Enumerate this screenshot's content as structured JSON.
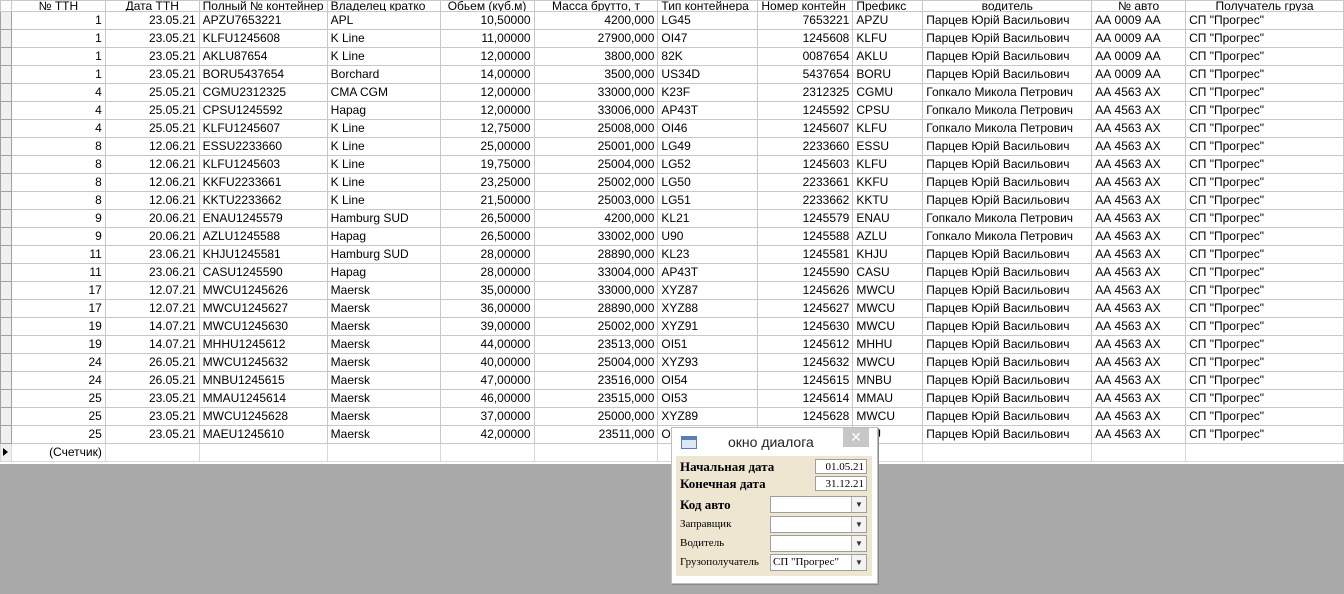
{
  "columns": [
    "№ ТТН",
    "Дата ТТН",
    "Полный № контейнер",
    "Владелец кратко",
    "Обьем (куб.м)",
    "Масса брутто, т",
    "Тип контейнера",
    "Номер контейн",
    "Префикс",
    "водитель",
    "№ авто",
    "Получатель груза"
  ],
  "rows": [
    [
      "1",
      "23.05.21",
      "APZU7653221",
      "APL",
      "10,50000",
      "4200,000",
      "LG45",
      "7653221",
      "APZU",
      "Парцев Юрій Васильович",
      "АА 0009 АА",
      "СП \"Прогрес\""
    ],
    [
      "1",
      "23.05.21",
      "KLFU1245608",
      "K Line",
      "11,00000",
      "27900,000",
      "OI47",
      "1245608",
      "KLFU",
      "Парцев Юрій Васильович",
      "АА 0009 АА",
      "СП \"Прогрес\""
    ],
    [
      "1",
      "23.05.21",
      "AKLU87654",
      "K Line",
      "12,00000",
      "3800,000",
      "82K",
      "0087654",
      "AKLU",
      "Парцев Юрій Васильович",
      "АА 0009 АА",
      "СП \"Прогрес\""
    ],
    [
      "1",
      "23.05.21",
      "BORU5437654",
      "Borchard",
      "14,00000",
      "3500,000",
      "US34D",
      "5437654",
      "BORU",
      "Парцев Юрій Васильович",
      "АА 0009 АА",
      "СП \"Прогрес\""
    ],
    [
      "4",
      "25.05.21",
      "CGMU2312325",
      "CMA CGM",
      "12,00000",
      "33000,000",
      "K23F",
      "2312325",
      "CGMU",
      "Гопкало Микола Петрович",
      "АА 4563 АХ",
      "СП \"Прогрес\""
    ],
    [
      "4",
      "25.05.21",
      "CPSU1245592",
      "Hapag",
      "12,00000",
      "33006,000",
      "AP43T",
      "1245592",
      "CPSU",
      "Гопкало Микола Петрович",
      "АА 4563 АХ",
      "СП \"Прогрес\""
    ],
    [
      "4",
      "25.05.21",
      "KLFU1245607",
      "K Line",
      "12,75000",
      "25008,000",
      "OI46",
      "1245607",
      "KLFU",
      "Гопкало Микола Петрович",
      "АА 4563 АХ",
      "СП \"Прогрес\""
    ],
    [
      "8",
      "12.06.21",
      "ESSU2233660",
      "K Line",
      "25,00000",
      "25001,000",
      "LG49",
      "2233660",
      "ESSU",
      "Парцев Юрій Васильович",
      "АА 4563 АХ",
      "СП \"Прогрес\""
    ],
    [
      "8",
      "12.06.21",
      "KLFU1245603",
      "K Line",
      "19,75000",
      "25004,000",
      "LG52",
      "1245603",
      "KLFU",
      "Парцев Юрій Васильович",
      "АА 4563 АХ",
      "СП \"Прогрес\""
    ],
    [
      "8",
      "12.06.21",
      "KKFU2233661",
      "K Line",
      "23,25000",
      "25002,000",
      "LG50",
      "2233661",
      "KKFU",
      "Парцев Юрій Васильович",
      "АА 4563 АХ",
      "СП \"Прогрес\""
    ],
    [
      "8",
      "12.06.21",
      "KKTU2233662",
      "K Line",
      "21,50000",
      "25003,000",
      "LG51",
      "2233662",
      "KKTU",
      "Парцев Юрій Васильович",
      "АА 4563 АХ",
      "СП \"Прогрес\""
    ],
    [
      "9",
      "20.06.21",
      "ENAU1245579",
      "Hamburg SUD",
      "26,50000",
      "4200,000",
      "KL21",
      "1245579",
      "ENAU",
      "Гопкало Микола Петрович",
      "АА 4563 АХ",
      "СП \"Прогрес\""
    ],
    [
      "9",
      "20.06.21",
      "AZLU1245588",
      "Hapag",
      "26,50000",
      "33002,000",
      "U90",
      "1245588",
      "AZLU",
      "Гопкало Микола Петрович",
      "АА 4563 АХ",
      "СП \"Прогрес\""
    ],
    [
      "11",
      "23.06.21",
      "KHJU1245581",
      "Hamburg SUD",
      "28,00000",
      "28890,000",
      "KL23",
      "1245581",
      "KHJU",
      "Парцев Юрій Васильович",
      "АА 4563 АХ",
      "СП \"Прогрес\""
    ],
    [
      "11",
      "23.06.21",
      "CASU1245590",
      "Hapag",
      "28,00000",
      "33004,000",
      "AP43T",
      "1245590",
      "CASU",
      "Парцев Юрій Васильович",
      "АА 4563 АХ",
      "СП \"Прогрес\""
    ],
    [
      "17",
      "12.07.21",
      "MWCU1245626",
      "Maersk",
      "35,00000",
      "33000,000",
      "XYZ87",
      "1245626",
      "MWCU",
      "Парцев Юрій Васильович",
      "АА 4563 АХ",
      "СП \"Прогрес\""
    ],
    [
      "17",
      "12.07.21",
      "MWCU1245627",
      "Maersk",
      "36,00000",
      "28890,000",
      "XYZ88",
      "1245627",
      "MWCU",
      "Парцев Юрій Васильович",
      "АА 4563 АХ",
      "СП \"Прогрес\""
    ],
    [
      "19",
      "14.07.21",
      "MWCU1245630",
      "Maersk",
      "39,00000",
      "25002,000",
      "XYZ91",
      "1245630",
      "MWCU",
      "Парцев Юрій Васильович",
      "АА 4563 АХ",
      "СП \"Прогрес\""
    ],
    [
      "19",
      "14.07.21",
      "MHHU1245612",
      "Maersk",
      "44,00000",
      "23513,000",
      "OI51",
      "1245612",
      "MHHU",
      "Парцев Юрій Васильович",
      "АА 4563 АХ",
      "СП \"Прогрес\""
    ],
    [
      "24",
      "26.05.21",
      "MWCU1245632",
      "Maersk",
      "40,00000",
      "25004,000",
      "XYZ93",
      "1245632",
      "MWCU",
      "Парцев Юрій Васильович",
      "АА 4563 АХ",
      "СП \"Прогрес\""
    ],
    [
      "24",
      "26.05.21",
      "MNBU1245615",
      "Maersk",
      "47,00000",
      "23516,000",
      "OI54",
      "1245615",
      "MNBU",
      "Парцев Юрій Васильович",
      "АА 4563 АХ",
      "СП \"Прогрес\""
    ],
    [
      "25",
      "23.05.21",
      "MMAU1245614",
      "Maersk",
      "46,00000",
      "23515,000",
      "OI53",
      "1245614",
      "MMAU",
      "Парцев Юрій Васильович",
      "АА 4563 АХ",
      "СП \"Прогрес\""
    ],
    [
      "25",
      "23.05.21",
      "MWCU1245628",
      "Maersk",
      "37,00000",
      "25000,000",
      "XYZ89",
      "1245628",
      "MWCU",
      "Парцев Юрій Васильович",
      "АА 4563 АХ",
      "СП \"Прогрес\""
    ],
    [
      "25",
      "23.05.21",
      "MAEU1245610",
      "Maersk",
      "42,00000",
      "23511,000",
      "O",
      "",
      "AEU",
      "Парцев Юрій Васильович",
      "АА 4563 АХ",
      "СП \"Прогрес\""
    ]
  ],
  "counter_label": "(Счетчик)",
  "dialog": {
    "title": "окно диалога",
    "close_glyph": "✕",
    "start_label": "Начальная дата",
    "start_value": "01.05.21",
    "end_label": "Конечная дата",
    "end_value": "31.12.21",
    "car_label": "Код авто",
    "car_value": "",
    "fueler_label": "Заправщик",
    "fueler_value": "",
    "driver_label": "Водитель",
    "driver_value": "",
    "consignee_label": "Грузополучатель",
    "consignee_value": "СП \"Прогрес\""
  }
}
